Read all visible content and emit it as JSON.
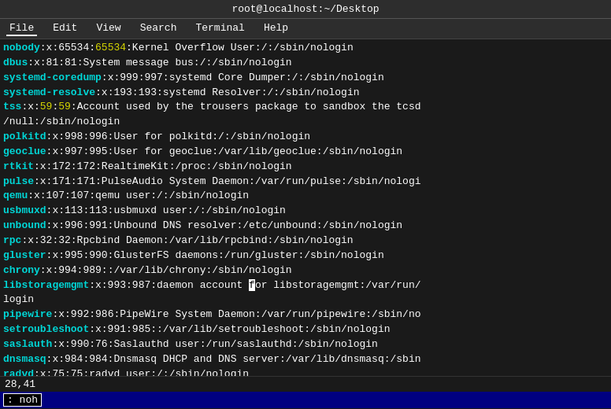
{
  "titlebar": {
    "text": "root@localhost:~/Desktop"
  },
  "menubar": {
    "items": [
      "File",
      "Edit",
      "View",
      "Search",
      "Terminal",
      "Help"
    ]
  },
  "terminal": {
    "lines": [
      {
        "parts": [
          {
            "text": "nobody",
            "color": "cyan",
            "bold": true
          },
          {
            "text": ":x:65534:",
            "color": "white"
          },
          {
            "text": "65534",
            "color": "yellow"
          },
          {
            "text": ":Kernel Overflow User:/:/sbin/nologin",
            "color": "white"
          }
        ]
      },
      {
        "parts": [
          {
            "text": "dbus",
            "color": "cyan",
            "bold": true
          },
          {
            "text": ":x:81:81:System message bus:/:/sbin/nologin",
            "color": "white"
          }
        ]
      },
      {
        "parts": [
          {
            "text": "systemd-coredump",
            "color": "cyan",
            "bold": true
          },
          {
            "text": ":x:999:997:systemd Core Dumper:/:/sbin/nologin",
            "color": "white"
          }
        ]
      },
      {
        "parts": [
          {
            "text": "systemd-resolve",
            "color": "cyan",
            "bold": true
          },
          {
            "text": ":x:193:193:systemd Resolver:/:/sbin/nologin",
            "color": "white"
          }
        ]
      },
      {
        "parts": [
          {
            "text": "tss",
            "color": "cyan",
            "bold": true
          },
          {
            "text": ":x:",
            "color": "white"
          },
          {
            "text": "59",
            "color": "yellow"
          },
          {
            "text": ":",
            "color": "white"
          },
          {
            "text": "59",
            "color": "yellow"
          },
          {
            "text": ":Account used by the trousers package to sandbox the tcsd",
            "color": "white"
          }
        ]
      },
      {
        "parts": [
          {
            "text": "/null:/sbin/nologin",
            "color": "white"
          }
        ]
      },
      {
        "parts": [
          {
            "text": "polkitd",
            "color": "cyan",
            "bold": true
          },
          {
            "text": ":x:998:996:User for polkitd:/:/sbin/nologin",
            "color": "white"
          }
        ]
      },
      {
        "parts": [
          {
            "text": "geoclue",
            "color": "cyan",
            "bold": true
          },
          {
            "text": ":x:997:995:User for geoclue:/var/lib/geoclue:/sbin/nologin",
            "color": "white"
          }
        ]
      },
      {
        "parts": [
          {
            "text": "rtkit",
            "color": "cyan",
            "bold": true
          },
          {
            "text": ":x:172:172:RealtimeKit:/proc:/sbin/nologin",
            "color": "white"
          }
        ]
      },
      {
        "parts": [
          {
            "text": "pulse",
            "color": "cyan",
            "bold": true
          },
          {
            "text": ":x:171:171:PulseAudio System Daemon:/var/run/pulse:/sbin/nologi",
            "color": "white"
          }
        ]
      },
      {
        "parts": [
          {
            "text": "qemu",
            "color": "cyan",
            "bold": true
          },
          {
            "text": ":x:107:107:qemu user:/:/sbin/nologin",
            "color": "white"
          }
        ]
      },
      {
        "parts": [
          {
            "text": "usbmuxd",
            "color": "cyan",
            "bold": true
          },
          {
            "text": ":x:113:113:usbmuxd user:/:/sbin/nologin",
            "color": "white"
          }
        ]
      },
      {
        "parts": [
          {
            "text": "unbound",
            "color": "cyan",
            "bold": true
          },
          {
            "text": ":x:996:991:Unbound DNS resolver:/etc/unbound:/sbin/nologin",
            "color": "white"
          }
        ]
      },
      {
        "parts": [
          {
            "text": "rpc",
            "color": "cyan",
            "bold": true
          },
          {
            "text": ":x:32:32:Rpcbind Daemon:/var/lib/rpcbind:/sbin/nologin",
            "color": "white"
          }
        ]
      },
      {
        "parts": [
          {
            "text": "gluster",
            "color": "cyan",
            "bold": true
          },
          {
            "text": ":x:995:990:GlusterFS daemons:/run/gluster:/sbin/nologin",
            "color": "white"
          }
        ]
      },
      {
        "parts": [
          {
            "text": "chrony",
            "color": "cyan",
            "bold": true
          },
          {
            "text": ":x:994:989::/var/lib/chrony:/sbin/nologin",
            "color": "white"
          }
        ]
      },
      {
        "parts": [
          {
            "text": "libstoragemgmt",
            "color": "cyan",
            "bold": true
          },
          {
            "text": ":x:993:987:daemon account ",
            "color": "white"
          },
          {
            "text": "f",
            "color": "white",
            "cursor": true
          },
          {
            "text": "or libstoragemgmt:/var/run/",
            "color": "white"
          }
        ]
      },
      {
        "parts": [
          {
            "text": "login",
            "color": "white"
          }
        ]
      },
      {
        "parts": [
          {
            "text": "pipewire",
            "color": "cyan",
            "bold": true
          },
          {
            "text": ":x:992:986:PipeWire System Daemon:/var/run/pipewire:/sbin/no",
            "color": "white"
          }
        ]
      },
      {
        "parts": [
          {
            "text": "setroubleshoot",
            "color": "cyan",
            "bold": true
          },
          {
            "text": ":x:991:985::/var/lib/setroubleshoot:/sbin/nologin",
            "color": "white"
          }
        ]
      },
      {
        "parts": [
          {
            "text": "saslauth",
            "color": "cyan",
            "bold": true
          },
          {
            "text": ":x:990:76:Saslauthd user:/run/saslauthd:/sbin/nologin",
            "color": "white"
          }
        ]
      },
      {
        "parts": [
          {
            "text": "dnsmasq",
            "color": "cyan",
            "bold": true
          },
          {
            "text": ":x:984:984:Dnsmasq DHCP and DNS server:/var/lib/dnsmasq:/sbin",
            "color": "white"
          }
        ]
      },
      {
        "parts": [
          {
            "text": "radvd",
            "color": "cyan",
            "bold": true
          },
          {
            "text": ":x:75:75:radvd user:/:/sbin/nologin",
            "color": "white"
          }
        ]
      }
    ]
  },
  "statusbar": {
    "position": "28,41",
    "url": "https://blog.csdn.net/X_pang"
  },
  "commandbar": {
    "noh_label": ": noh"
  }
}
